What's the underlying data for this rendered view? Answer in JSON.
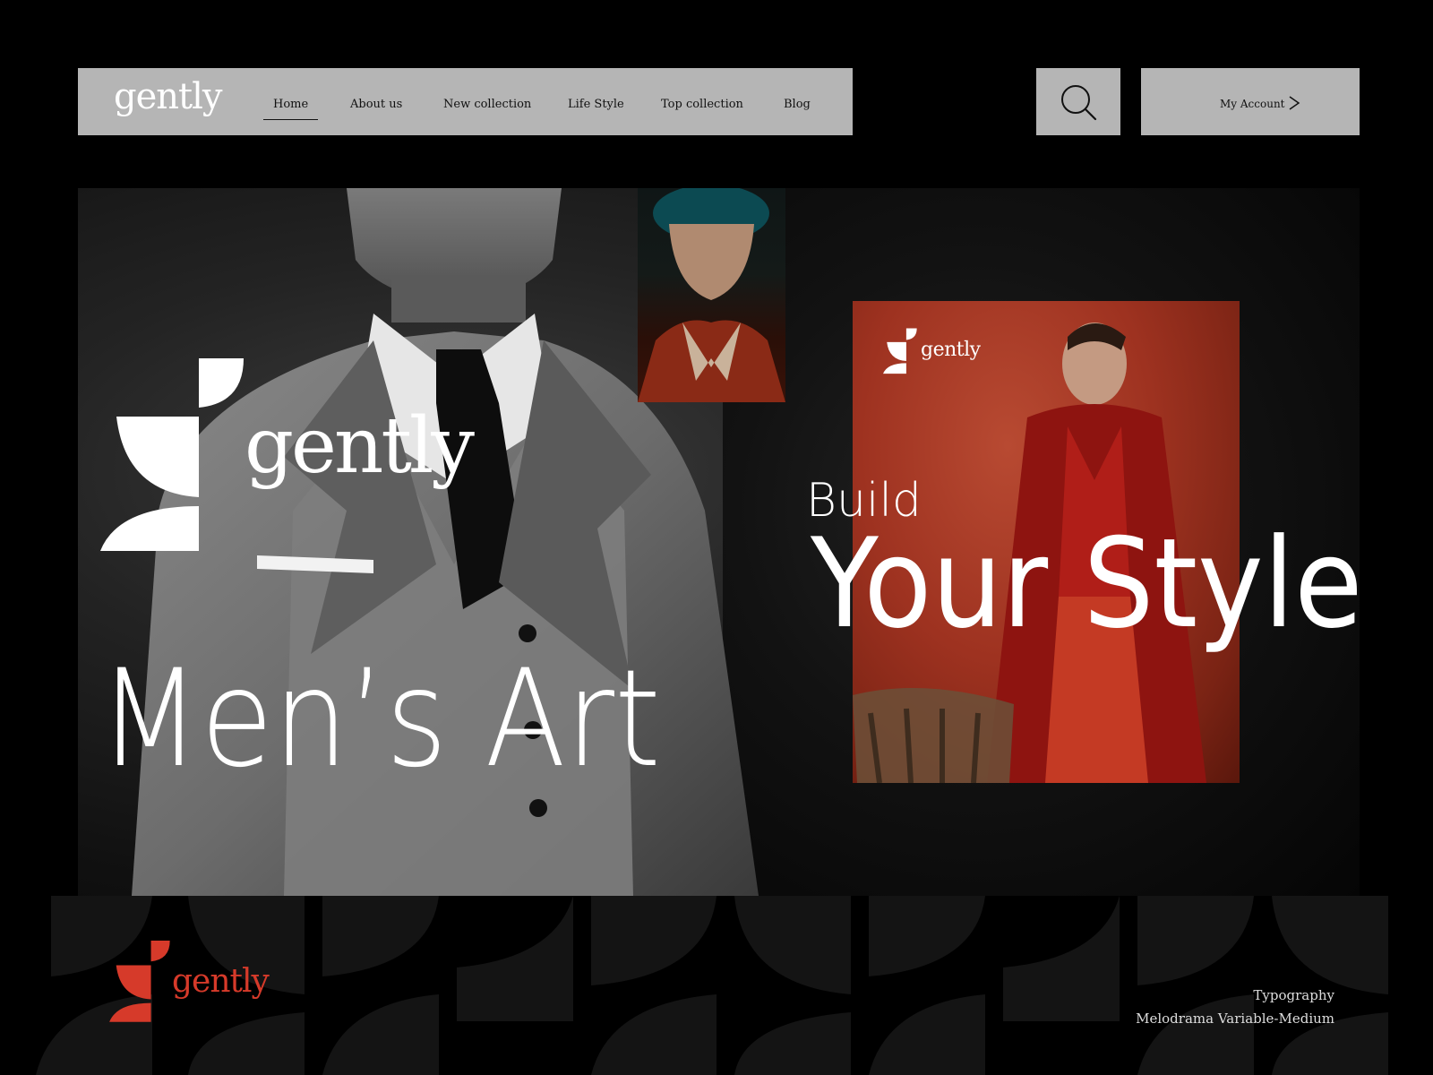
{
  "brand": {
    "name": "gently",
    "accent_color": "#d63a2a",
    "nav_bg": "#b5b5b5"
  },
  "nav": {
    "items": [
      {
        "label": "Home",
        "active": true
      },
      {
        "label": "About us"
      },
      {
        "label": "New collection"
      },
      {
        "label": "Life Style"
      },
      {
        "label": "Top collection"
      },
      {
        "label": "Blog"
      }
    ],
    "search_icon": "search-icon",
    "account_label": "My Account",
    "account_icon": "chevron-right-icon"
  },
  "hero": {
    "headline": "Men’s Art",
    "tagline_small": "Build",
    "tagline_large": "Your Style"
  },
  "footer": {
    "typography_label": "Typography",
    "typography_value": "Melodrama Variable-Medium"
  }
}
